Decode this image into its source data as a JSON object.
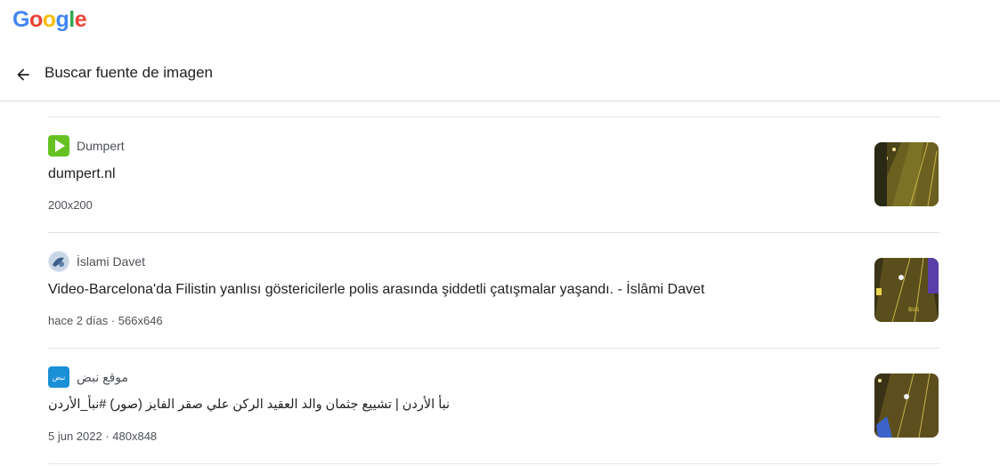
{
  "app": {
    "logo": [
      "G",
      "o",
      "o",
      "g",
      "l",
      "e"
    ],
    "logo_colors": [
      "#4285F4",
      "#EA4335",
      "#FBBC05",
      "#4285F4",
      "#34A853",
      "#EA4335"
    ]
  },
  "header": {
    "back_icon": "arrow-left-icon",
    "title": "Buscar fuente de imagen"
  },
  "results": [
    {
      "source": "Dumpert",
      "favicon_color": "#66c221",
      "title": "dumpert.nl",
      "meta": "200x200"
    },
    {
      "source": "İslami Davet",
      "favicon_color": "#6d8fb8",
      "title": "Video-Barcelona'da Filistin yanlısı göstericilerle polis arasında şiddetli çatışmalar yaşandı. - İslâmi Davet",
      "meta": "hace 2 días · 566x646"
    },
    {
      "source": "موقع نبض",
      "favicon_color": "#1a8fd6",
      "favicon_text": "نبض",
      "title": "نبأ الأردن | تشييع جثمان والد العقيد الركن علي صقر الفايز (صور) #نبأ_الأردن",
      "meta": "5 jun 2022 · 480x848"
    }
  ]
}
